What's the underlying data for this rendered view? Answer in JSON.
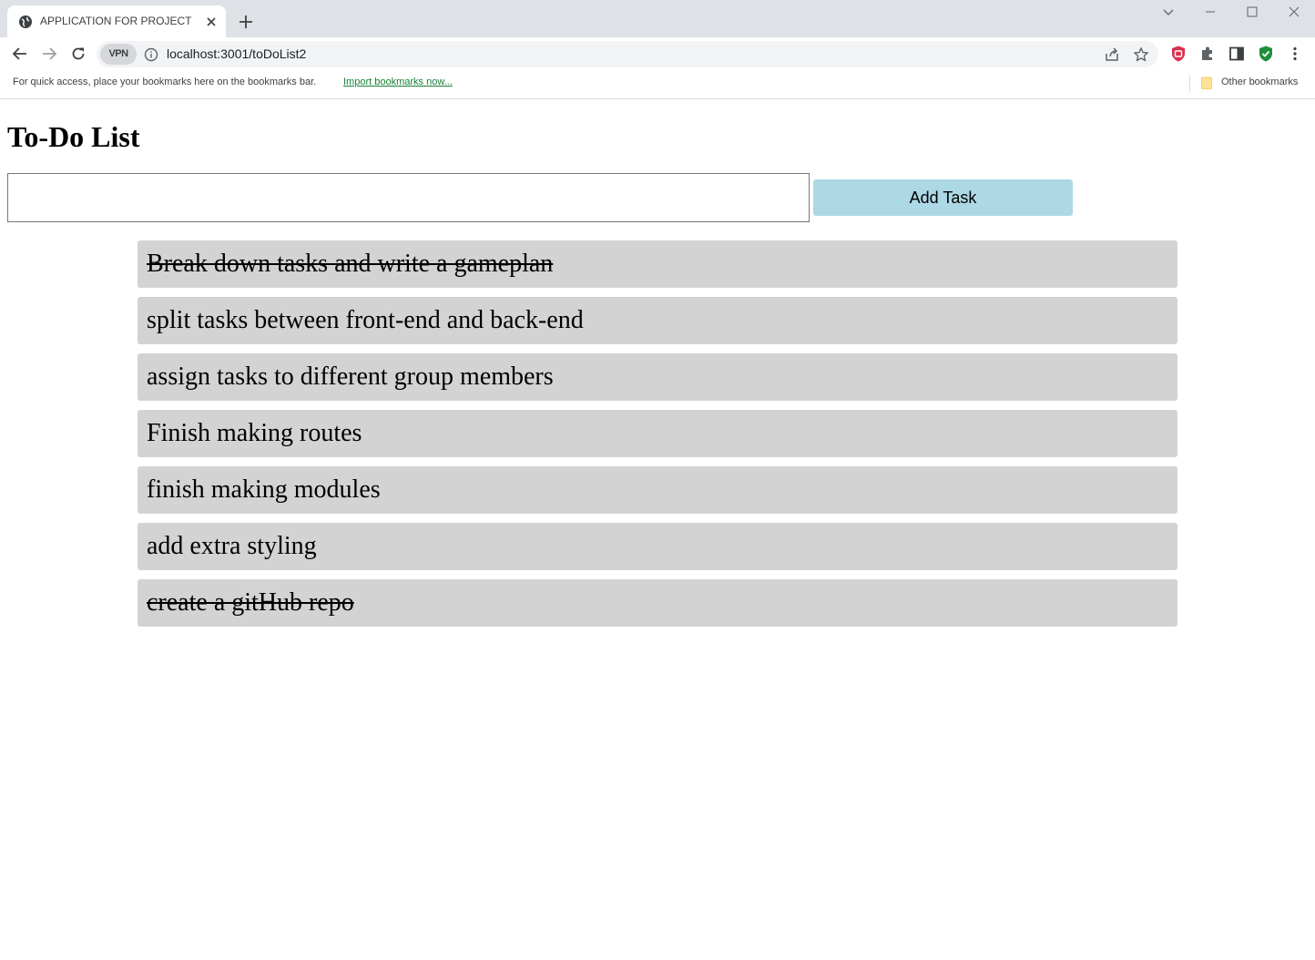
{
  "browser": {
    "tab": {
      "title": "APPLICATION FOR PROJECT"
    },
    "toolbar": {
      "vpn_label": "VPN",
      "url": "localhost:3001/toDoList2"
    },
    "bookmarks_bar": {
      "message": "For quick access, place your bookmarks here on the bookmarks bar.",
      "import_link": "Import bookmarks now...",
      "other_bookmarks": "Other bookmarks"
    }
  },
  "page": {
    "title": "To-Do List",
    "input": {
      "value": "",
      "placeholder": ""
    },
    "add_button_label": "Add Task",
    "tasks": [
      {
        "text": "Break down tasks and write a gameplan",
        "completed": true
      },
      {
        "text": "split tasks between front-end and back-end",
        "completed": false
      },
      {
        "text": "assign tasks to different group members",
        "completed": false
      },
      {
        "text": "Finish making routes",
        "completed": false
      },
      {
        "text": "finish making modules",
        "completed": false
      },
      {
        "text": "add extra styling",
        "completed": false
      },
      {
        "text": "create a gitHub repo",
        "completed": true
      }
    ]
  }
}
